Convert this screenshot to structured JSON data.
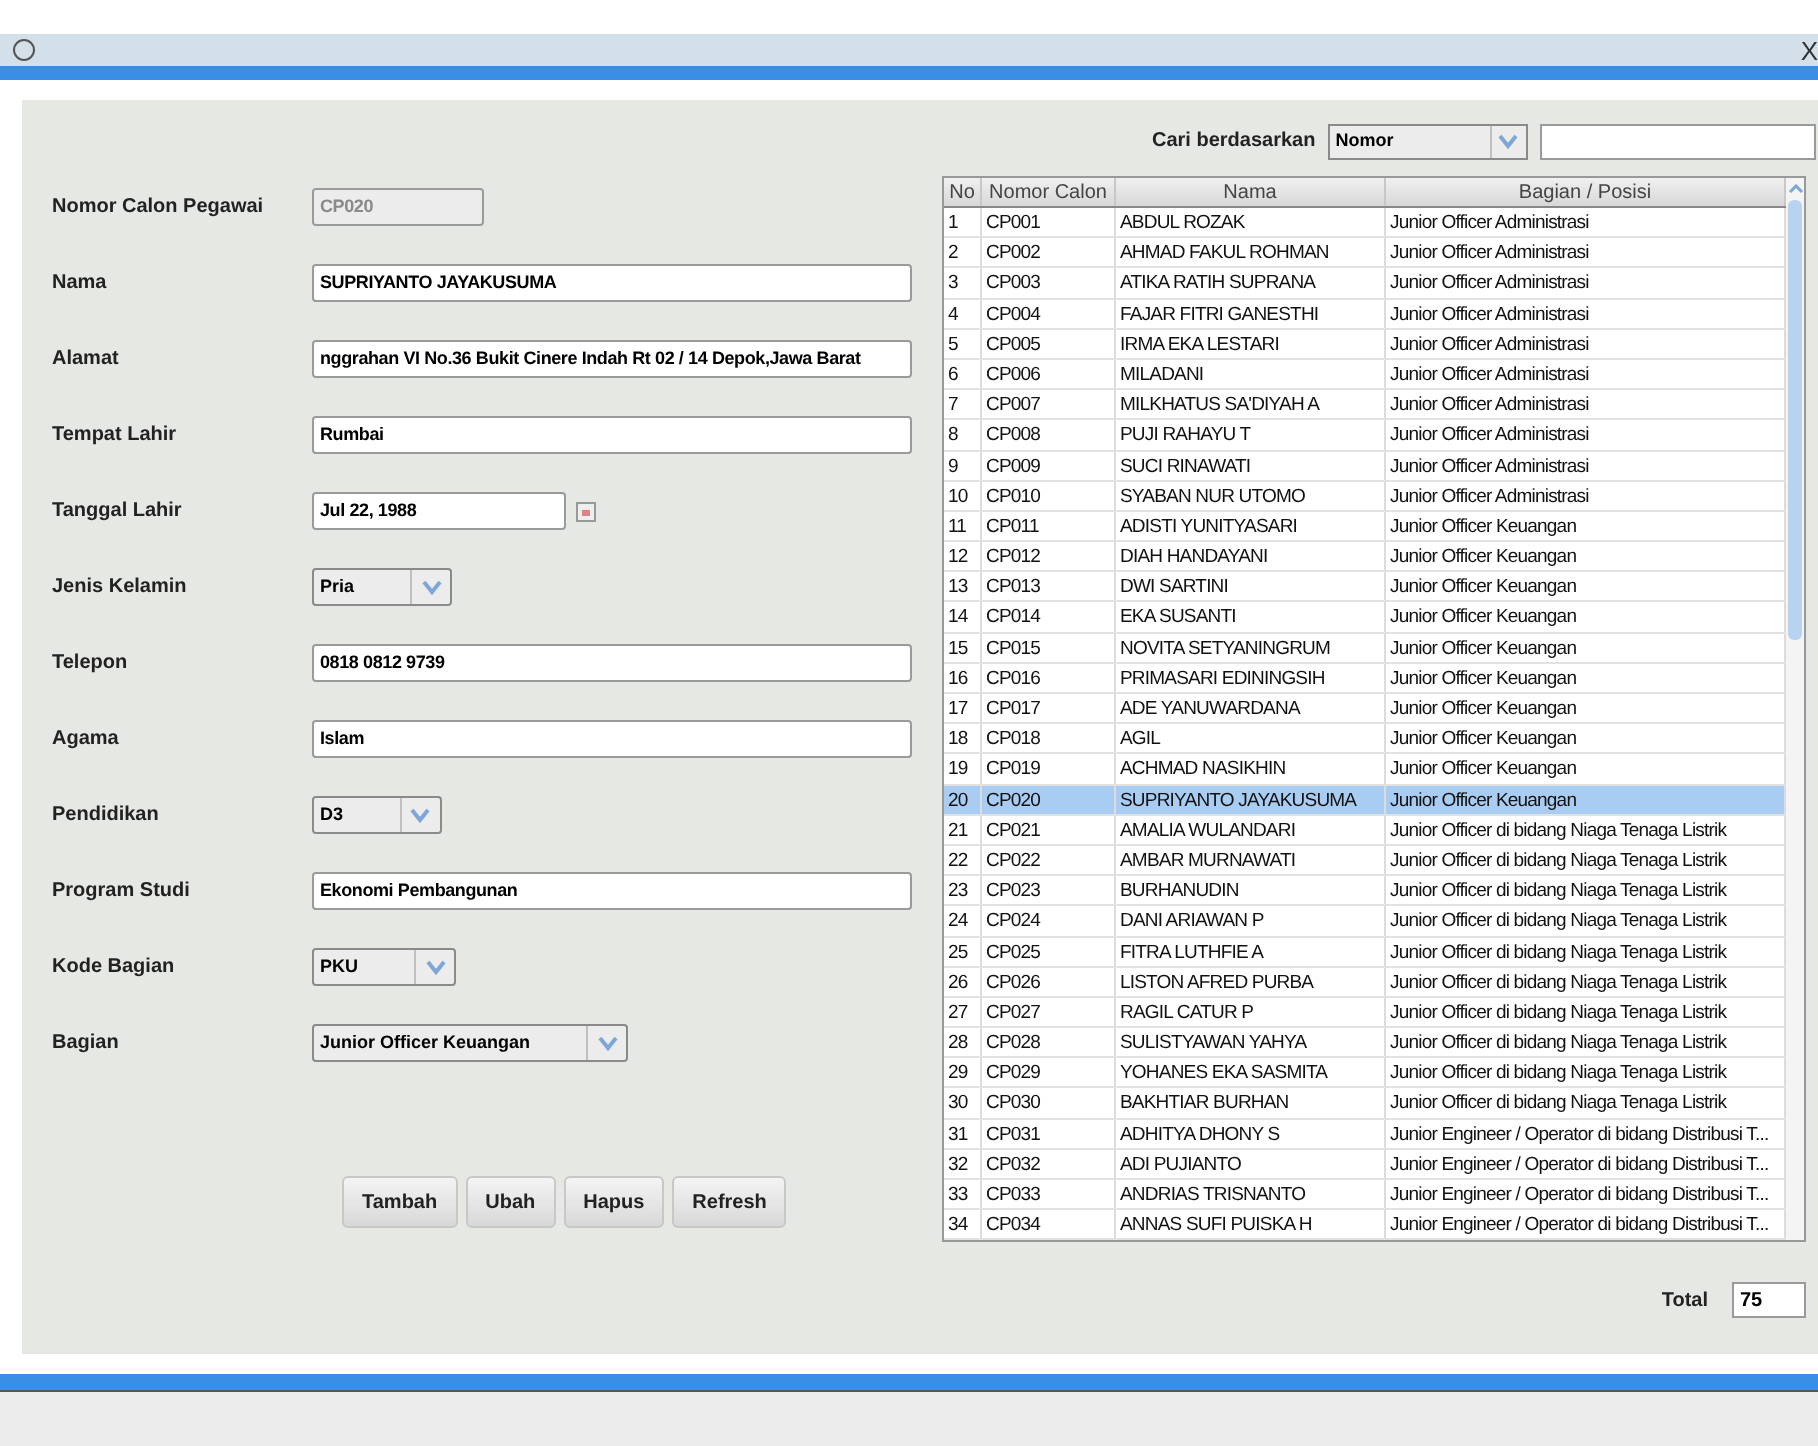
{
  "title_bar": {
    "close": "X"
  },
  "search": {
    "label": "Cari berdasarkan",
    "by": "Nomor"
  },
  "form": [
    {
      "label": "Nomor Calon Pegawai",
      "kind": "text",
      "value": "CP020",
      "disabled": true
    },
    {
      "label": "Nama",
      "kind": "text",
      "value": "SUPRIYANTO JAYAKUSUMA",
      "disabled": false
    },
    {
      "label": "Alamat",
      "kind": "text",
      "value": "nggrahan VI No.36 Bukit Cinere Indah Rt 02 / 14 Depok,Jawa Barat",
      "disabled": false
    },
    {
      "label": "Tempat Lahir",
      "kind": "text",
      "value": "Rumbai",
      "disabled": false
    },
    {
      "label": "Tanggal Lahir",
      "kind": "date",
      "value": "Jul 22, 1988",
      "disabled": false
    },
    {
      "label": "Jenis Kelamin",
      "kind": "select",
      "value": "Pria",
      "disabled": false
    },
    {
      "label": "Telepon",
      "kind": "text",
      "value": "0818 0812 9739",
      "disabled": false
    },
    {
      "label": "Agama",
      "kind": "text",
      "value": "Islam",
      "disabled": false
    },
    {
      "label": "Pendidikan",
      "kind": "select",
      "value": "D3",
      "disabled": false
    },
    {
      "label": "Program Studi",
      "kind": "text",
      "value": "Ekonomi Pembangunan",
      "disabled": false
    },
    {
      "label": "Kode Bagian",
      "kind": "select",
      "value": "PKU",
      "disabled": false
    },
    {
      "label": "Bagian",
      "kind": "select",
      "value": "Junior Officer Keuangan",
      "disabled": false
    }
  ],
  "buttons": [
    "Tambah",
    "Ubah",
    "Hapus",
    "Refresh"
  ],
  "table": {
    "columns": [
      "No",
      "Nomor Calon",
      "Nama",
      "Bagian / Posisi"
    ],
    "rows": [
      {
        "cells": [
          "1",
          "CP001",
          "ABDUL ROZAK",
          "Junior Officer Administrasi"
        ],
        "selected": false
      },
      {
        "cells": [
          "2",
          "CP002",
          "AHMAD FAKUL ROHMAN",
          "Junior Officer Administrasi"
        ],
        "selected": false
      },
      {
        "cells": [
          "3",
          "CP003",
          "ATIKA RATIH SUPRANA",
          "Junior Officer Administrasi"
        ],
        "selected": false
      },
      {
        "cells": [
          "4",
          "CP004",
          "FAJAR FITRI GANESTHI",
          "Junior Officer Administrasi"
        ],
        "selected": false
      },
      {
        "cells": [
          "5",
          "CP005",
          "IRMA EKA LESTARI",
          "Junior Officer Administrasi"
        ],
        "selected": false
      },
      {
        "cells": [
          "6",
          "CP006",
          "MILADANI",
          "Junior Officer Administrasi"
        ],
        "selected": false
      },
      {
        "cells": [
          "7",
          "CP007",
          "MILKHATUS SA'DIYAH A",
          "Junior Officer Administrasi"
        ],
        "selected": false
      },
      {
        "cells": [
          "8",
          "CP008",
          "PUJI RAHAYU T",
          "Junior Officer Administrasi"
        ],
        "selected": false
      },
      {
        "cells": [
          "9",
          "CP009",
          "SUCI RINAWATI",
          "Junior Officer Administrasi"
        ],
        "selected": false
      },
      {
        "cells": [
          "10",
          "CP010",
          "SYABAN NUR UTOMO",
          "Junior Officer Administrasi"
        ],
        "selected": false
      },
      {
        "cells": [
          "11",
          "CP011",
          "ADISTI YUNITYASARI",
          "Junior Officer Keuangan"
        ],
        "selected": false
      },
      {
        "cells": [
          "12",
          "CP012",
          "DIAH HANDAYANI",
          "Junior Officer Keuangan"
        ],
        "selected": false
      },
      {
        "cells": [
          "13",
          "CP013",
          "DWI SARTINI",
          "Junior Officer Keuangan"
        ],
        "selected": false
      },
      {
        "cells": [
          "14",
          "CP014",
          "EKA SUSANTI",
          "Junior Officer Keuangan"
        ],
        "selected": false
      },
      {
        "cells": [
          "15",
          "CP015",
          "NOVITA SETYANINGRUM",
          "Junior Officer Keuangan"
        ],
        "selected": false
      },
      {
        "cells": [
          "16",
          "CP016",
          "PRIMASARI EDININGSIH",
          "Junior Officer Keuangan"
        ],
        "selected": false
      },
      {
        "cells": [
          "17",
          "CP017",
          "ADE YANUWARDANA",
          "Junior Officer Keuangan"
        ],
        "selected": false
      },
      {
        "cells": [
          "18",
          "CP018",
          "AGIL",
          "Junior Officer Keuangan"
        ],
        "selected": false
      },
      {
        "cells": [
          "19",
          "CP019",
          "ACHMAD NASIKHIN",
          "Junior Officer Keuangan"
        ],
        "selected": false
      },
      {
        "cells": [
          "20",
          "CP020",
          "SUPRIYANTO JAYAKUSUMA",
          "Junior Officer Keuangan"
        ],
        "selected": true
      },
      {
        "cells": [
          "21",
          "CP021",
          "AMALIA WULANDARI",
          "Junior Officer di bidang Niaga Tenaga Listrik"
        ],
        "selected": false
      },
      {
        "cells": [
          "22",
          "CP022",
          "AMBAR MURNAWATI",
          "Junior Officer di bidang Niaga Tenaga Listrik"
        ],
        "selected": false
      },
      {
        "cells": [
          "23",
          "CP023",
          "BURHANUDIN",
          "Junior Officer di bidang Niaga Tenaga Listrik"
        ],
        "selected": false
      },
      {
        "cells": [
          "24",
          "CP024",
          "DANI ARIAWAN P",
          "Junior Officer di bidang Niaga Tenaga Listrik"
        ],
        "selected": false
      },
      {
        "cells": [
          "25",
          "CP025",
          "FITRA LUTHFIE A",
          "Junior Officer di bidang Niaga Tenaga Listrik"
        ],
        "selected": false
      },
      {
        "cells": [
          "26",
          "CP026",
          "LISTON AFRED PURBA",
          "Junior Officer di bidang Niaga Tenaga Listrik"
        ],
        "selected": false
      },
      {
        "cells": [
          "27",
          "CP027",
          "RAGIL CATUR P",
          "Junior Officer di bidang Niaga Tenaga Listrik"
        ],
        "selected": false
      },
      {
        "cells": [
          "28",
          "CP028",
          "SULISTYAWAN YAHYA",
          "Junior Officer di bidang Niaga Tenaga Listrik"
        ],
        "selected": false
      },
      {
        "cells": [
          "29",
          "CP029",
          "YOHANES EKA SASMITA",
          "Junior Officer di bidang Niaga Tenaga Listrik"
        ],
        "selected": false
      },
      {
        "cells": [
          "30",
          "CP030",
          "BAKHTIAR BURHAN",
          "Junior Officer di bidang Niaga Tenaga Listrik"
        ],
        "selected": false
      },
      {
        "cells": [
          "31",
          "CP031",
          "ADHITYA DHONY S",
          "Junior Engineer / Operator di bidang Distribusi T..."
        ],
        "selected": false
      },
      {
        "cells": [
          "32",
          "CP032",
          "ADI PUJIANTO",
          "Junior Engineer / Operator di bidang Distribusi T..."
        ],
        "selected": false
      },
      {
        "cells": [
          "33",
          "CP033",
          "ANDRIAS TRISNANTO",
          "Junior Engineer / Operator di bidang Distribusi T..."
        ],
        "selected": false
      },
      {
        "cells": [
          "34",
          "CP034",
          "ANNAS SUFI PUISKA H",
          "Junior Engineer / Operator di bidang Distribusi T..."
        ],
        "selected": false
      }
    ]
  },
  "total": {
    "label": "Total",
    "value": "75"
  }
}
